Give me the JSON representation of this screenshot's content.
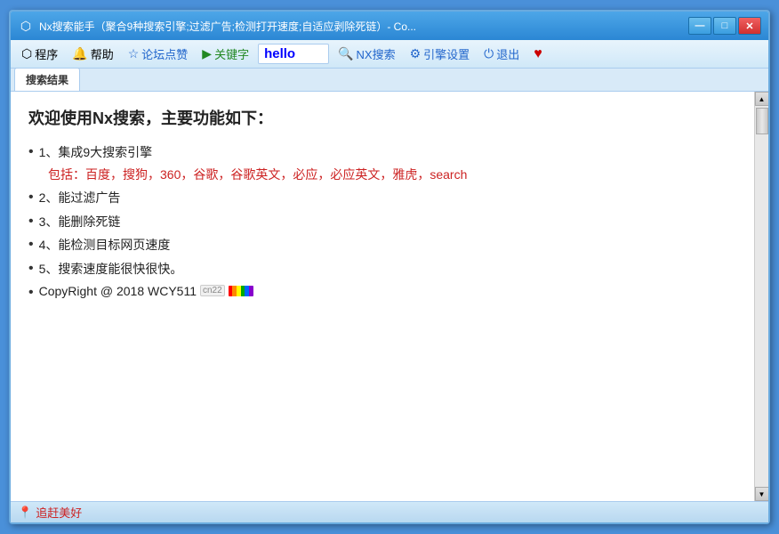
{
  "window": {
    "title": "Nx搜索能手（聚合9种搜索引擎;过滤广告;检测打开速度;自适应剥除死链）- Co...",
    "title_icon": "⬡",
    "controls": {
      "minimize": "—",
      "maximize": "□",
      "close": "✕"
    }
  },
  "menubar": {
    "items": [
      {
        "icon": "⬡",
        "label": "程序",
        "color": "default"
      },
      {
        "icon": "🔔",
        "label": "帮助",
        "color": "default"
      },
      {
        "icon": "☆",
        "label": "论坛点赞",
        "color": "blue"
      },
      {
        "icon": "▶",
        "label": "关键字",
        "color": "green"
      },
      {
        "keyword": "hello"
      },
      {
        "icon": "🔍",
        "label": "NX搜索",
        "color": "blue"
      },
      {
        "icon": "⚙",
        "label": "引擎设置",
        "color": "blue"
      },
      {
        "icon": "⏻",
        "label": "退出",
        "color": "blue"
      },
      {
        "icon": "♥",
        "label": "",
        "color": "heart"
      }
    ],
    "keyword_value": "hello",
    "keyword_placeholder": "hello"
  },
  "tabs": [
    {
      "label": "搜索结果",
      "active": true
    }
  ],
  "content": {
    "welcome_title": "欢迎使用Nx搜索，主要功能如下：",
    "features": [
      {
        "bullet": "•",
        "text": "1、集成9大搜索引擎",
        "subtext": "包括：百度，搜狗，360，谷歌，谷歌英文，必应，必应英文，雅虎，search"
      },
      {
        "bullet": "•",
        "text": "2、能过滤广告"
      },
      {
        "bullet": "•",
        "text": "3、能删除死链"
      },
      {
        "bullet": "•",
        "text": "4、能检测目标网页速度"
      },
      {
        "bullet": "•",
        "text": "5、搜索速度能很快很快。"
      },
      {
        "bullet": "•",
        "text": "CopyRight @ 2018 WCY511",
        "has_badge": true,
        "badge": "cn22",
        "has_flag": true
      }
    ]
  },
  "statusbar": {
    "pin_icon": "📍",
    "text": "追赶美好"
  },
  "rainbow_colors": [
    "#ff0000",
    "#ff8800",
    "#ffff00",
    "#00aa00",
    "#0066ff",
    "#8800cc"
  ]
}
